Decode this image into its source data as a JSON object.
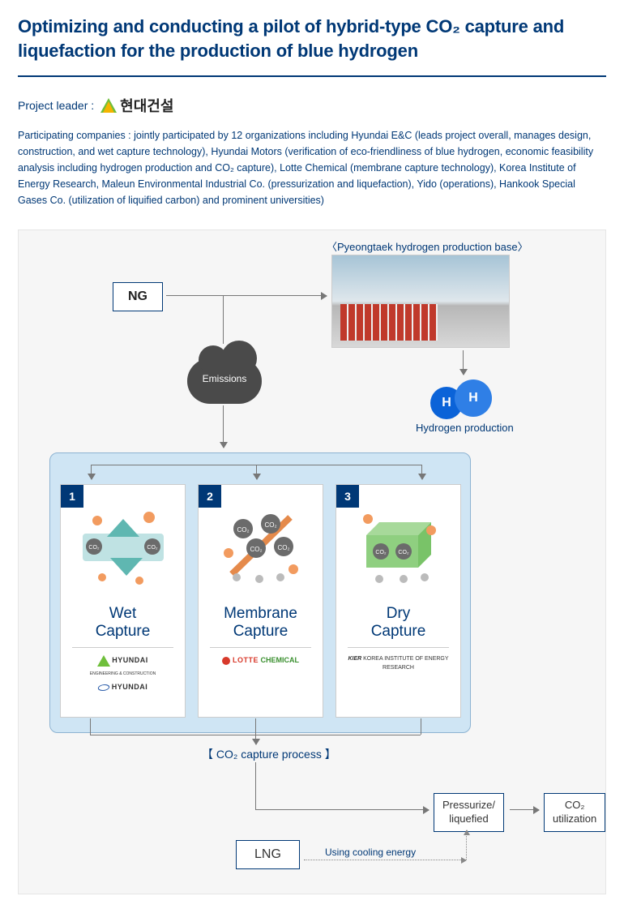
{
  "title": "Optimizing and conducting a pilot of hybrid-type CO₂ capture and liquefaction for the production of blue hydrogen",
  "project_leader_label": "Project leader :",
  "project_leader_logo": "현대건설",
  "participants": "Participating companies : jointly participated by 12 organizations including Hyundai E&C (leads project overall, manages design, construction, and wet capture technology), Hyundai Motors (verification of eco-friendliness of blue hydrogen, economic feasibility analysis including hydrogen production and CO₂ capture), Lotte Chemical (membrane capture technology), Korea Institute of Energy Research, Maleun Environmental Industrial Co. (pressurization and liquefaction), Yido (operations), Hankook Special Gases Co. (utilization of liquified carbon) and prominent universities)",
  "diagram": {
    "ng": "NG",
    "facility_caption": "〈Pyeongtaek hydrogen production base〉",
    "emissions": "Emissions",
    "h2_a": "H",
    "h2_b": "H",
    "h2_label": "Hydrogen production",
    "cards": [
      {
        "num": "1",
        "title": "Wet\nCapture",
        "logos": "HYUNDAI ENGINEERING & CONSTRUCTION · HYUNDAI"
      },
      {
        "num": "2",
        "title": "Membrane\nCapture",
        "logos": "LOTTE CHEMICAL"
      },
      {
        "num": "3",
        "title": "Dry\nCapture",
        "logos": "KOREA INSTITUTE OF ENERGY RESEARCH"
      }
    ],
    "capture_caption": "【 CO₂ capture process 】",
    "pressurize": "Pressurize/\nliquefied",
    "co2_util": "CO₂\nutilization",
    "lng": "LNG",
    "cooling": "Using cooling energy"
  }
}
